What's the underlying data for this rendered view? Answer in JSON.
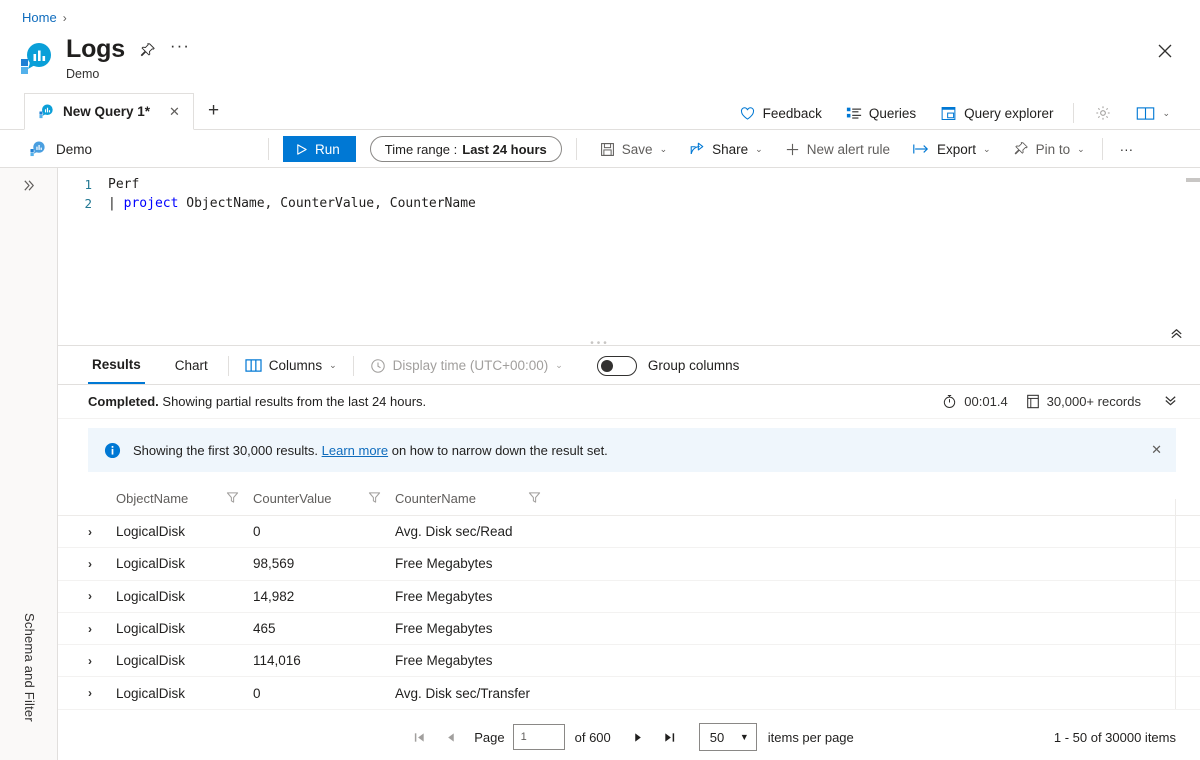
{
  "breadcrumb": {
    "home": "Home",
    "separator": "›"
  },
  "header": {
    "title": "Logs",
    "subtitle": "Demo",
    "pin_icon": "pin-icon",
    "more_icon": "ellipsis-icon",
    "close_icon": "close-icon"
  },
  "tabs": {
    "items": [
      {
        "label": "New Query 1*",
        "close": "✕",
        "active": true
      }
    ],
    "add_label": "+"
  },
  "top_actions": [
    {
      "label": "Feedback",
      "icon": "heart-icon"
    },
    {
      "label": "Queries",
      "icon": "list-icon"
    },
    {
      "label": "Query explorer",
      "icon": "explorer-icon"
    }
  ],
  "top_action_icons": [
    {
      "icon": "gear-icon"
    },
    {
      "icon": "book-icon"
    },
    {
      "icon": "chevron-down-icon"
    }
  ],
  "commandbar": {
    "scope": "Demo",
    "run_label": "Run",
    "time_range_prefix": "Time range :",
    "time_range_value": "Last 24 hours",
    "items": [
      {
        "label": "Save",
        "icon": "save-icon",
        "caret": true
      },
      {
        "label": "Share",
        "icon": "share-icon",
        "caret": true
      },
      {
        "label": "New alert rule",
        "icon": "plus-icon",
        "caret": false
      },
      {
        "label": "Export",
        "icon": "export-icon",
        "caret": true
      },
      {
        "label": "Pin to",
        "icon": "pin-icon",
        "caret": true
      }
    ],
    "overflow": "···"
  },
  "leftrail": {
    "expand_icon": "double-chevron-right-icon",
    "vertical_label": "Schema and Filter"
  },
  "editor": {
    "line_numbers": [
      "1",
      "2"
    ],
    "line1": "Perf",
    "line2_pipe": "| ",
    "line2_keyword": "project",
    "line2_rest": " ObjectName, CounterValue, CounterName",
    "collapse_icon": "double-chevron-up-icon"
  },
  "results": {
    "tabs": [
      {
        "label": "Results",
        "active": true
      },
      {
        "label": "Chart",
        "active": false
      }
    ],
    "columns_btn": "Columns",
    "display_time": "Display time (UTC+00:00)",
    "group_columns": "Group columns",
    "group_columns_on": false,
    "status_bold": "Completed.",
    "status_rest": " Showing partial results from the last 24 hours.",
    "duration": "00:01.4",
    "records": "30,000+ records",
    "status_expand_icon": "chevron-double-down-icon"
  },
  "banner": {
    "text_before": "Showing the first 30,000 results.",
    "link": "Learn more",
    "text_after": "on how to narrow down the result set.",
    "close": "✕",
    "icon": "info-icon"
  },
  "grid": {
    "columns": [
      "ObjectName",
      "CounterValue",
      "CounterName"
    ],
    "rows": [
      {
        "ObjectName": "LogicalDisk",
        "CounterValue": "0",
        "CounterName": "Avg. Disk sec/Read"
      },
      {
        "ObjectName": "LogicalDisk",
        "CounterValue": "98,569",
        "CounterName": "Free Megabytes"
      },
      {
        "ObjectName": "LogicalDisk",
        "CounterValue": "14,982",
        "CounterName": "Free Megabytes"
      },
      {
        "ObjectName": "LogicalDisk",
        "CounterValue": "465",
        "CounterName": "Free Megabytes"
      },
      {
        "ObjectName": "LogicalDisk",
        "CounterValue": "114,016",
        "CounterName": "Free Megabytes"
      },
      {
        "ObjectName": "LogicalDisk",
        "CounterValue": "0",
        "CounterName": "Avg. Disk sec/Transfer"
      }
    ],
    "expand_glyph": "›"
  },
  "pager": {
    "first_icon": "first-page-icon",
    "prev_icon": "prev-page-icon",
    "page_label": "Page",
    "page_value": "1",
    "of_label": "of 600",
    "next_icon": "next-page-icon",
    "last_icon": "last-page-icon",
    "page_size": "50",
    "items_per_page": "items per page",
    "range_text": "1 - 50 of 30000 items"
  },
  "colors": {
    "accent": "#0078d4",
    "link": "#0f6cbd",
    "banner_bg": "#eff6fc",
    "rail_bg": "#faf9f8",
    "border": "#e1dfdd"
  }
}
